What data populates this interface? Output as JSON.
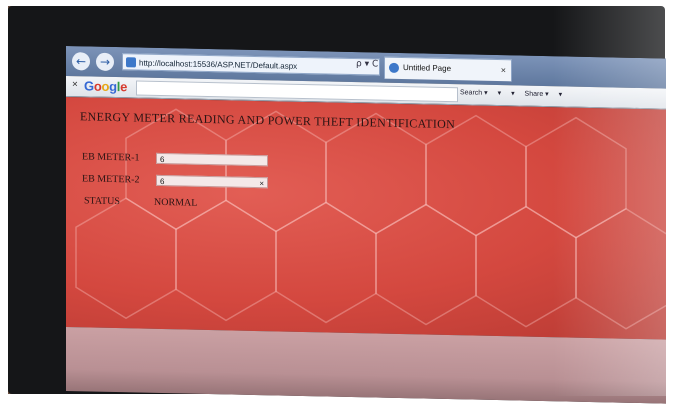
{
  "browser": {
    "address_url": "http://localhost:15536/ASP.NET/Default.aspx",
    "address_tools": "ρ ▾ C",
    "tab_title": "Untitled Page",
    "tab_close": "×",
    "back_glyph": "←",
    "forward_glyph": "→"
  },
  "toolbar": {
    "close_glyph": "×",
    "google": [
      "G",
      "o",
      "o",
      "g",
      "l",
      "e"
    ],
    "items": [
      "Search ▾",
      "▾",
      "▾",
      "Share ▾",
      "▾"
    ]
  },
  "page": {
    "title": "ENERGY METER READING AND POWER THEFT IDENTIFICATION",
    "meter1": {
      "label": "EB METER-1",
      "value": "6"
    },
    "meter2": {
      "label": "EB METER-2",
      "value": "6",
      "clear": "×"
    },
    "status": {
      "label": "STATUS",
      "value": "NORMAL"
    }
  },
  "colors": {
    "page_background": "#d4483f",
    "text": "#2b1414",
    "bezel": "#151618"
  },
  "icons": [
    "back-icon",
    "forward-icon",
    "ie-page-icon",
    "close-icon",
    "clear-icon"
  ]
}
